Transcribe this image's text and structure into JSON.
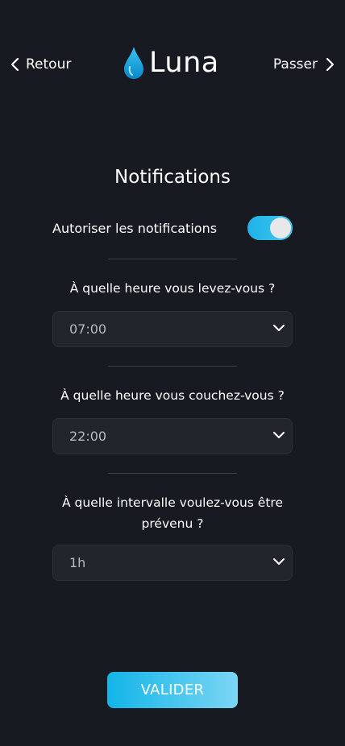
{
  "header": {
    "back_label": "Retour",
    "skip_label": "Passer",
    "brand_name": "Luna"
  },
  "colors": {
    "background": "#181a21",
    "accent": "#1eb3e8",
    "field_background": "#23252d"
  },
  "notifications": {
    "title": "Notifications",
    "toggle_label": "Autoriser les notifications",
    "toggle_on": true
  },
  "questions": [
    {
      "label": "À quelle heure vous levez-vous ?",
      "value": "07:00"
    },
    {
      "label": "À quelle heure vous couchez-vous ?",
      "value": "22:00"
    },
    {
      "label": "À quelle intervalle voulez-vous être prévenu ?",
      "value": "1h"
    }
  ],
  "submit_label": "VALIDER",
  "icons": {
    "back": "chevron-left-icon",
    "skip": "chevron-right-icon",
    "brand": "water-drop-icon",
    "select": "chevron-down-icon"
  }
}
